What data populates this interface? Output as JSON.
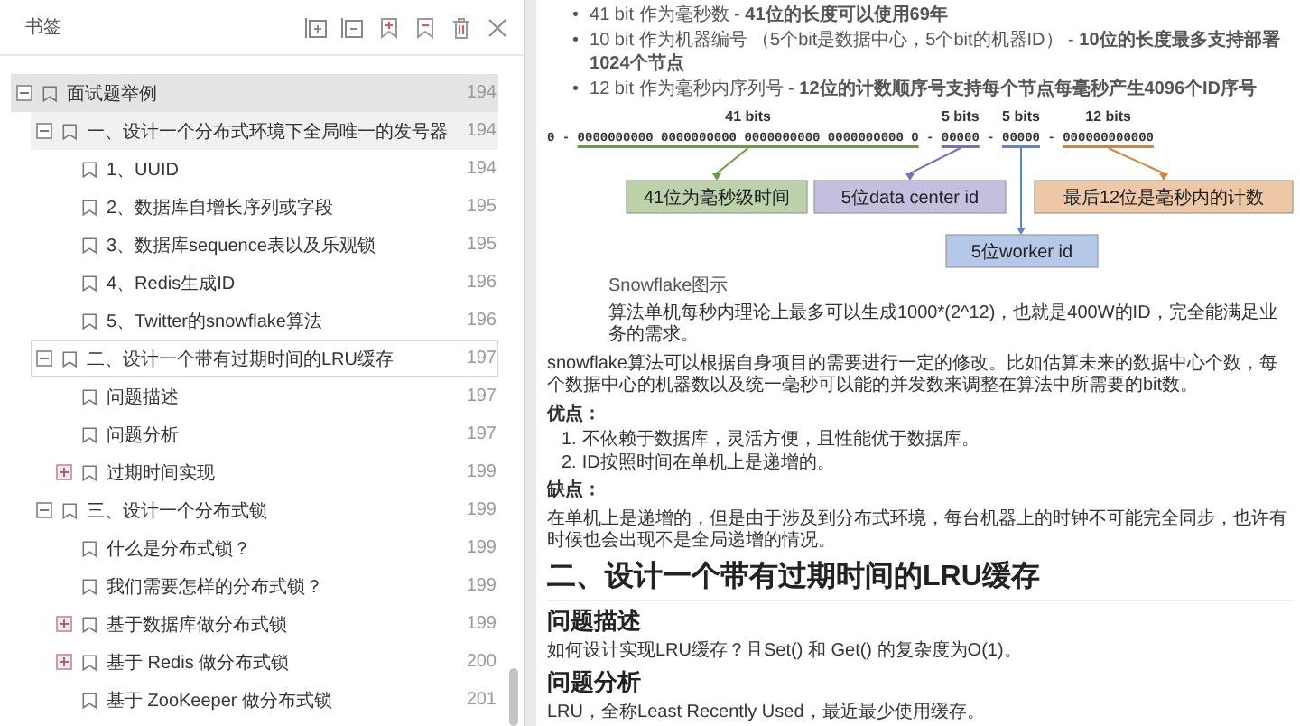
{
  "sidebar": {
    "title": "书签",
    "tree": [
      {
        "label": "面试题举例",
        "page": "194",
        "expanded": true,
        "selected": true,
        "hovered": false,
        "focused": false,
        "children": [
          {
            "label": "一、设计一个分布式环境下全局唯一的发号器",
            "page": "194",
            "expanded": true,
            "selected": false,
            "hovered": true,
            "focused": false,
            "children": [
              {
                "label": "1、UUID",
                "page": "194",
                "selected": false,
                "hovered": false,
                "focused": false
              },
              {
                "label": "2、数据库自增长序列或字段",
                "page": "195",
                "selected": false,
                "hovered": false,
                "focused": false
              },
              {
                "label": "3、数据库sequence表以及乐观锁",
                "page": "195",
                "selected": false,
                "hovered": false,
                "focused": false
              },
              {
                "label": "4、Redis生成ID",
                "page": "196",
                "selected": false,
                "hovered": false,
                "focused": false
              },
              {
                "label": "5、Twitter的snowflake算法",
                "page": "196",
                "selected": false,
                "hovered": false,
                "focused": false
              }
            ]
          },
          {
            "label": "二、设计一个带有过期时间的LRU缓存",
            "page": "197",
            "expanded": true,
            "selected": false,
            "hovered": false,
            "focused": true,
            "children": [
              {
                "label": "问题描述",
                "page": "197",
                "selected": false,
                "hovered": false,
                "focused": false
              },
              {
                "label": "问题分析",
                "page": "197",
                "selected": false,
                "hovered": false,
                "focused": false
              },
              {
                "label": "过期时间实现",
                "page": "199",
                "expanded": false,
                "selected": false,
                "hovered": false,
                "focused": false
              }
            ]
          },
          {
            "label": "三、设计一个分布式锁",
            "page": "199",
            "expanded": true,
            "selected": false,
            "hovered": false,
            "focused": false,
            "children": [
              {
                "label": "什么是分布式锁？",
                "page": "199",
                "selected": false,
                "hovered": false,
                "focused": false
              },
              {
                "label": "我们需要怎样的分布式锁？",
                "page": "199",
                "selected": false,
                "hovered": false,
                "focused": false
              },
              {
                "label": "基于数据库做分布式锁",
                "page": "199",
                "expanded": false,
                "selected": false,
                "hovered": false,
                "focused": false
              },
              {
                "label": "基于 Redis 做分布式锁",
                "page": "200",
                "expanded": false,
                "selected": false,
                "hovered": false,
                "focused": false
              },
              {
                "label": "基于 ZooKeeper 做分布式锁",
                "page": "201",
                "selected": false,
                "hovered": false,
                "focused": false
              }
            ]
          }
        ]
      }
    ]
  },
  "document": {
    "blocks": [
      {
        "kind": "bullets",
        "items": [
          {
            "marker": "•",
            "text": "41 bit 作为毫秒数 - **41位的长度可以使用69年**"
          },
          {
            "marker": "•",
            "text": "10 bit 作为机器编号 （5个bit是数据中心，5个bit的机器ID） - **10位的长度最多支持部署1024个节点**"
          },
          {
            "marker": "•",
            "text": "12 bit 作为毫秒内序列号 - **12位的计数顺序号支持每个节点每毫秒产生4096个ID序号**"
          }
        ]
      },
      {
        "kind": "diagram",
        "lead": "0",
        "separator": "-",
        "segments": [
          {
            "label": "41 bits",
            "bits": "0000000000 0000000000 0000000000 0000000000 0",
            "color": "#6a9b45",
            "box": "41位为毫秒级时间"
          },
          {
            "label": "5 bits",
            "bits": "00000",
            "color": "#7c6fb8",
            "box": "5位data center id"
          },
          {
            "label": "5 bits",
            "bits": "00000",
            "color": "#5b86c9",
            "box": "5位worker id"
          },
          {
            "label": "12 bits",
            "bits": "000000000000",
            "color": "#d9823a",
            "box": "最后12位是毫秒内的计数"
          }
        ]
      },
      {
        "kind": "caption",
        "text": "Snowflake图示"
      },
      {
        "kind": "indented",
        "text": "算法单机每秒内理论上最多可以生成1000*(2^12)，也就是400W的ID，完全能满足业务的需求。"
      },
      {
        "kind": "paragraph",
        "text": "snowflake算法可以根据自身项目的需要进行一定的修改。比如估算未来的数据中心个数，每个数据中心的机器数以及统一毫秒可以能的并发数来调整在算法中所需要的bit数。"
      },
      {
        "kind": "label",
        "text": "优点："
      },
      {
        "kind": "ordered",
        "items": [
          {
            "marker": "1.",
            "text": "不依赖于数据库，灵活方便，且性能优于数据库。"
          },
          {
            "marker": "2.",
            "text": "ID按照时间在单机上是递增的。"
          }
        ]
      },
      {
        "kind": "label",
        "text": "缺点："
      },
      {
        "kind": "paragraph",
        "text": "在单机上是递增的，但是由于涉及到分布式环境，每台机器上的时钟不可能完全同步，也许有时候也会出现不是全局递增的情况。"
      },
      {
        "kind": "h2",
        "text": "二、设计一个带有过期时间的LRU缓存"
      },
      {
        "kind": "h3",
        "text": "问题描述"
      },
      {
        "kind": "paragraph",
        "text": "如何设计实现LRU缓存？且Set() 和 Get() 的复杂度为O(1)。"
      },
      {
        "kind": "h3",
        "text": "问题分析"
      },
      {
        "kind": "paragraph",
        "text": "LRU，全称Least Recently Used，最近最少使用缓存。"
      }
    ]
  }
}
